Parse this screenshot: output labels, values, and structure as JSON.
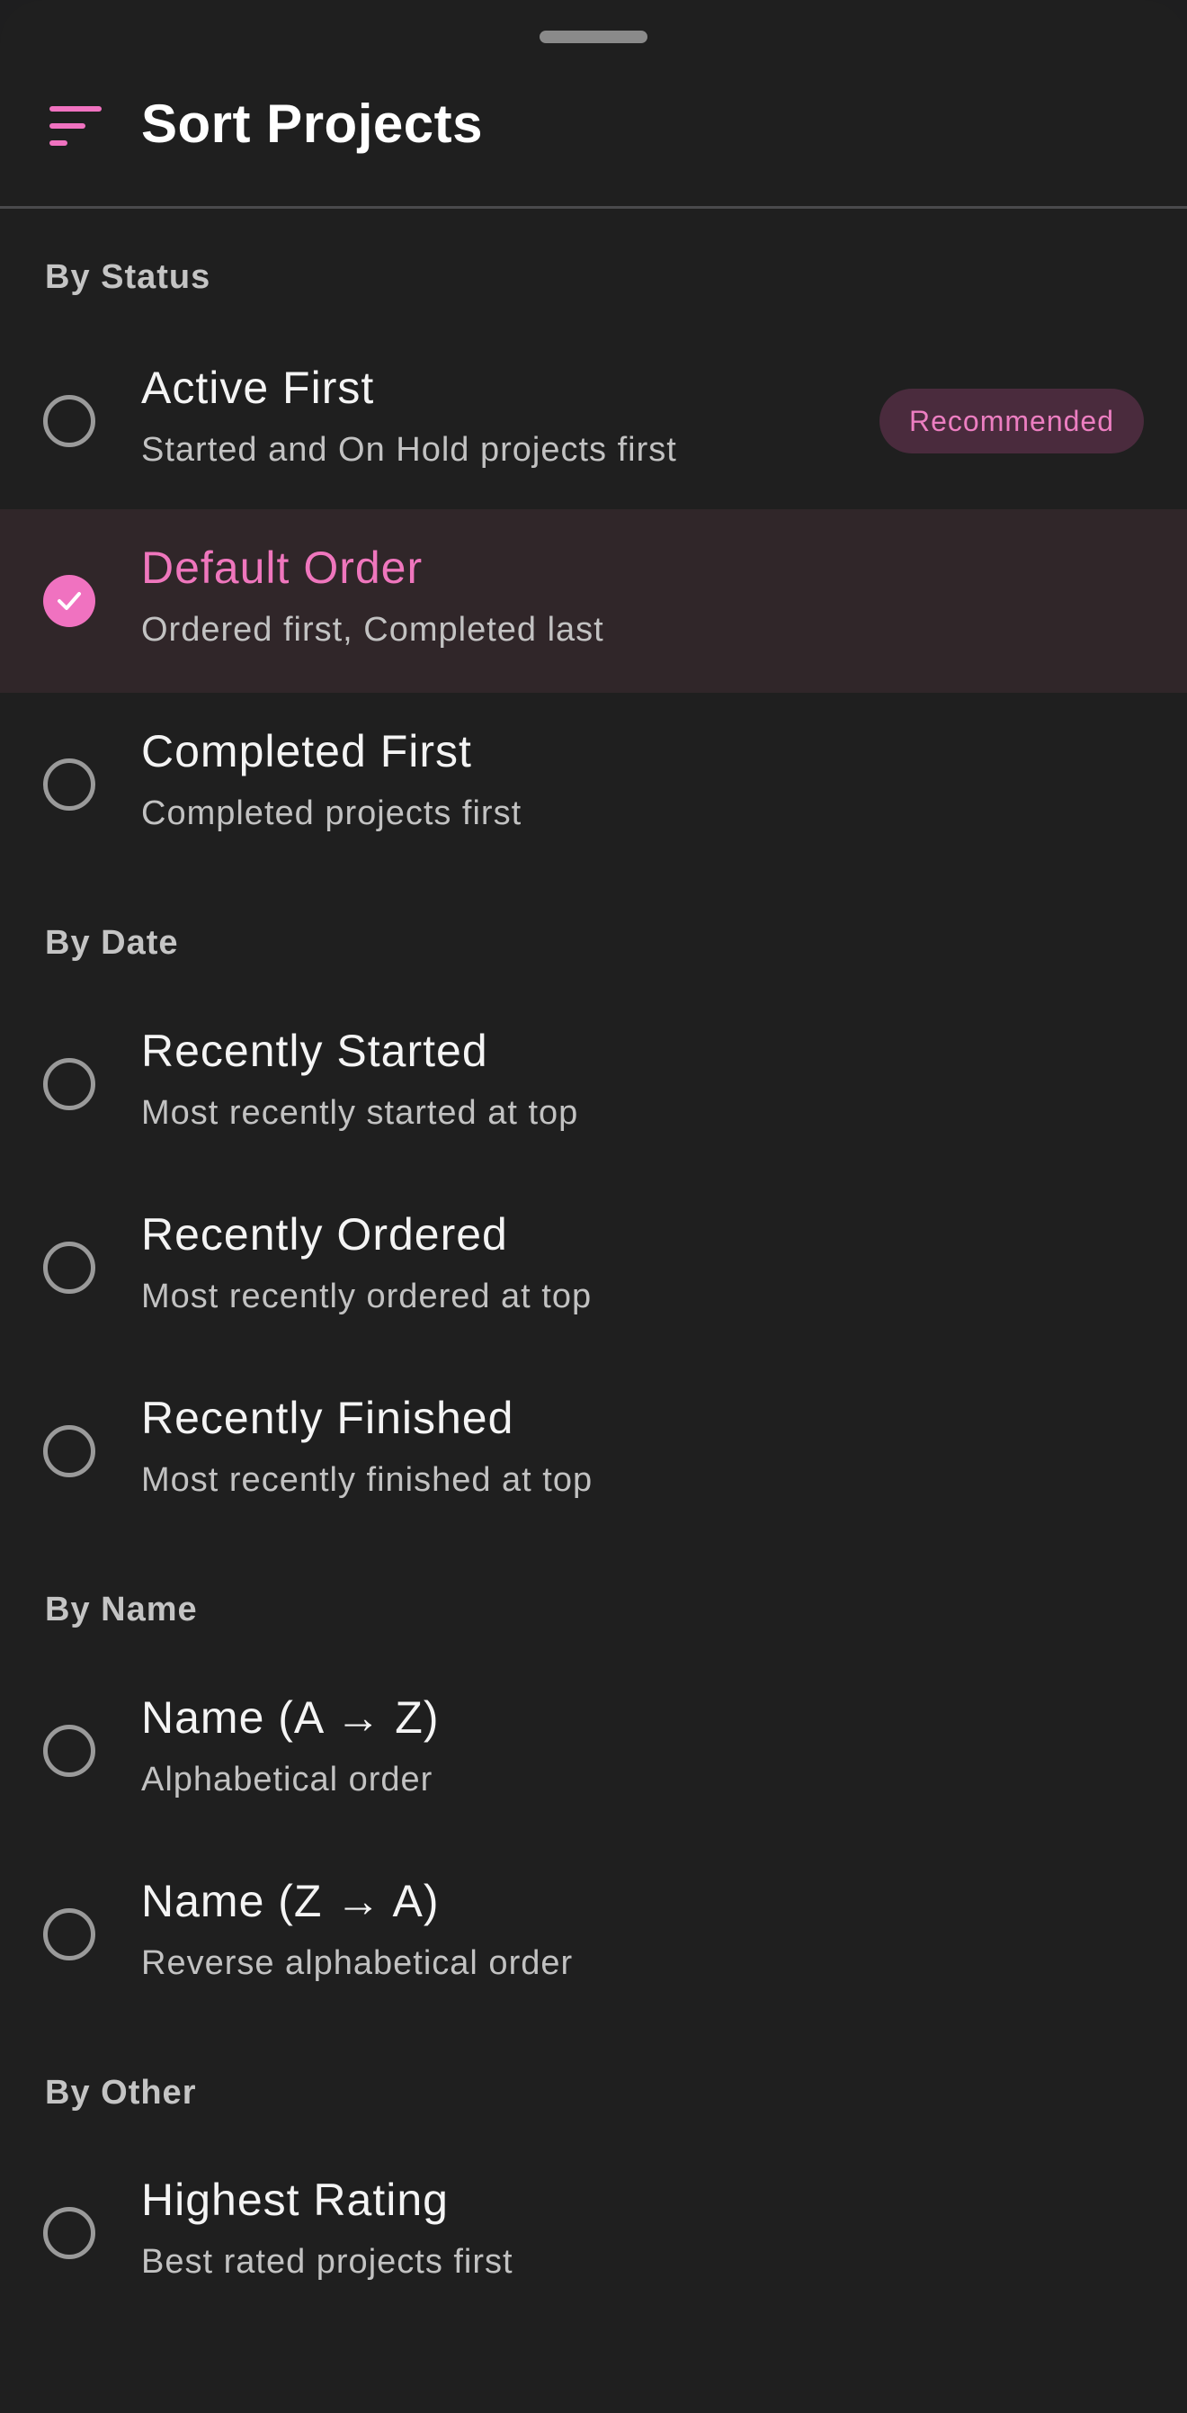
{
  "sheet": {
    "title": "Sort Projects",
    "accent_color": "#f072c0",
    "icon": "sort-icon"
  },
  "sections": [
    {
      "title": "By Status",
      "options": [
        {
          "label": "Active First",
          "description": "Started and On Hold projects first",
          "badge": "Recommended",
          "selected": false
        },
        {
          "label": "Default Order",
          "description": "Ordered first, Completed last",
          "selected": true
        },
        {
          "label": "Completed First",
          "description": "Completed projects first",
          "selected": false
        }
      ]
    },
    {
      "title": "By Date",
      "options": [
        {
          "label": "Recently Started",
          "description": "Most recently started at top",
          "selected": false
        },
        {
          "label": "Recently Ordered",
          "description": "Most recently ordered at top",
          "selected": false
        },
        {
          "label": "Recently Finished",
          "description": "Most recently finished at top",
          "selected": false
        }
      ]
    },
    {
      "title": "By Name",
      "options": [
        {
          "label": "Name (A → Z)",
          "description": "Alphabetical order",
          "selected": false
        },
        {
          "label": "Name (Z → A)",
          "description": "Reverse alphabetical order",
          "selected": false
        }
      ]
    },
    {
      "title": "By Other",
      "options": [
        {
          "label": "Highest Rating",
          "description": "Best rated projects first",
          "selected": false
        }
      ]
    }
  ]
}
